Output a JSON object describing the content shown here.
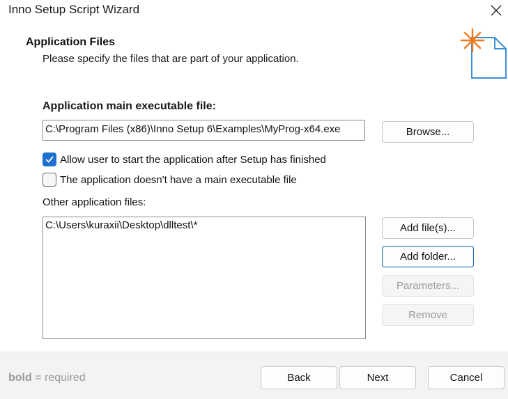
{
  "window": {
    "title": "Inno Setup Script Wizard"
  },
  "header": {
    "title": "Application Files",
    "subtitle": "Please specify the files that are part of your application."
  },
  "main_exe": {
    "label": "Application main executable file:",
    "value": "C:\\Program Files (x86)\\Inno Setup 6\\Examples\\MyProg-x64.exe",
    "browse_label": "Browse..."
  },
  "options": {
    "allow_start": {
      "label": "Allow user to start the application after Setup has finished",
      "checked": true
    },
    "no_main_exe": {
      "label": "The application doesn't have a main executable file",
      "checked": false
    }
  },
  "other_files": {
    "label": "Other application files:",
    "items": [
      "C:\\Users\\kuraxii\\Desktop\\dlltest\\*"
    ],
    "add_files_label": "Add file(s)...",
    "add_folder_label": "Add folder...",
    "parameters_label": "Parameters...",
    "remove_label": "Remove"
  },
  "footer": {
    "hint_bold": "bold",
    "hint_rest": " = required",
    "back_label": "Back",
    "next_label": "Next",
    "cancel_label": "Cancel"
  },
  "colors": {
    "accent": "#1f6fd0",
    "focus_border": "#2d6fb5",
    "icon_blue": "#3a8ed6",
    "icon_orange": "#f07a1a"
  }
}
